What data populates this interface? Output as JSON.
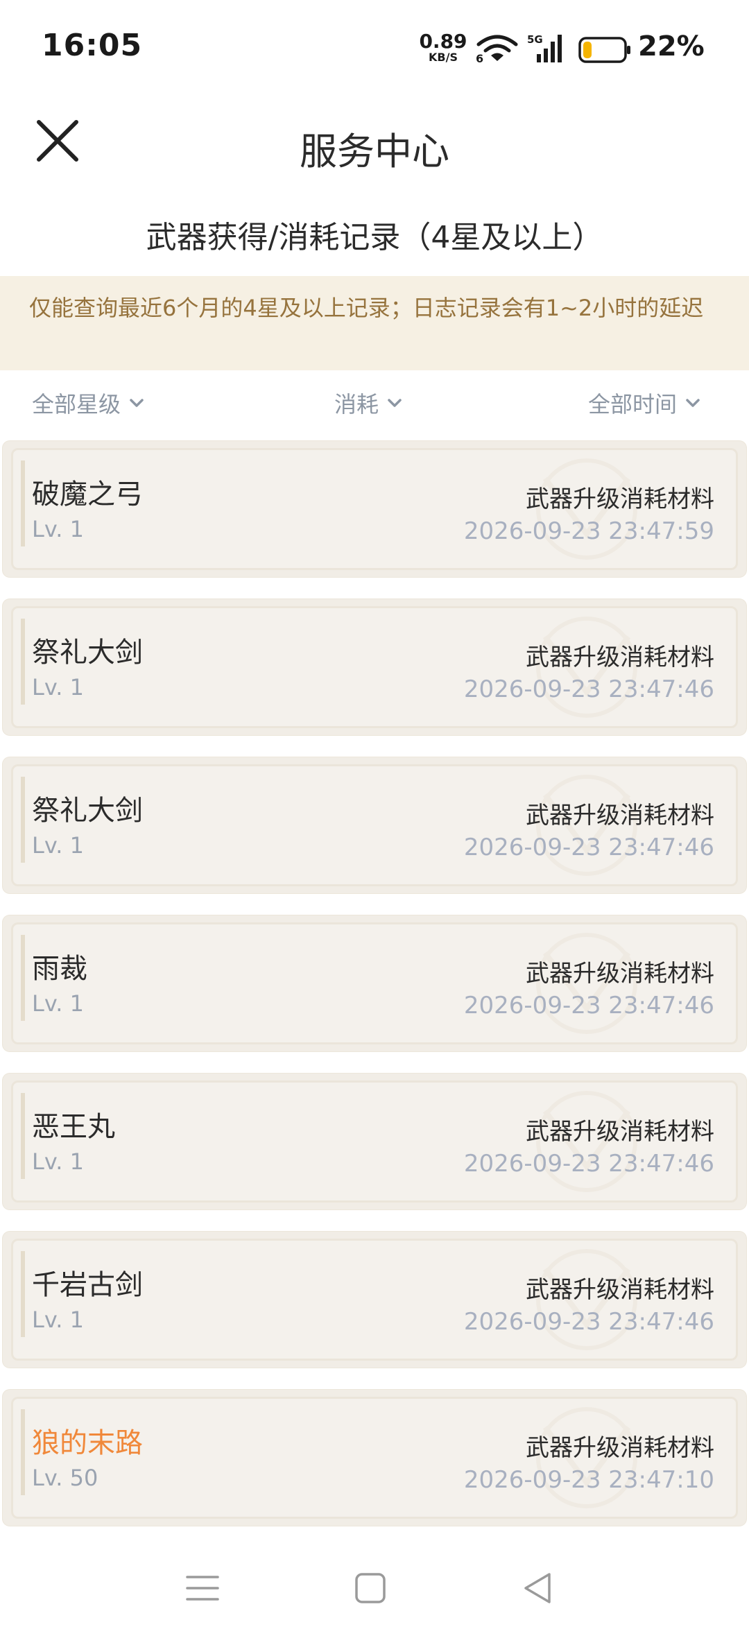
{
  "status_bar": {
    "time": "16:05",
    "net_speed_value": "0.89",
    "net_speed_unit": "KB/S",
    "wifi_badge": "6",
    "signal_badge": "5G",
    "battery_percent": "22%",
    "battery_level": 0.22
  },
  "header": {
    "title": "服务中心",
    "close_icon": "close-icon"
  },
  "section_title": "武器获得/消耗记录（4星及以上）",
  "notice": "仅能查询最近6个月的4星及以上记录；日志记录会有1~2小时的延迟",
  "filters": {
    "rarity": "全部星级",
    "type": "消耗",
    "time": "全部时间"
  },
  "records": [
    {
      "name": "破魔之弓",
      "level": "Lv. 1",
      "type": "武器升级消耗材料",
      "time": "2026-09-23 23:47:59",
      "rarity": "4"
    },
    {
      "name": "祭礼大剑",
      "level": "Lv. 1",
      "type": "武器升级消耗材料",
      "time": "2026-09-23 23:47:46",
      "rarity": "4"
    },
    {
      "name": "祭礼大剑",
      "level": "Lv. 1",
      "type": "武器升级消耗材料",
      "time": "2026-09-23 23:47:46",
      "rarity": "4"
    },
    {
      "name": "雨裁",
      "level": "Lv. 1",
      "type": "武器升级消耗材料",
      "time": "2026-09-23 23:47:46",
      "rarity": "4"
    },
    {
      "name": "恶王丸",
      "level": "Lv. 1",
      "type": "武器升级消耗材料",
      "time": "2026-09-23 23:47:46",
      "rarity": "4"
    },
    {
      "name": "千岩古剑",
      "level": "Lv. 1",
      "type": "武器升级消耗材料",
      "time": "2026-09-23 23:47:46",
      "rarity": "4"
    },
    {
      "name": "狼的末路",
      "level": "Lv. 50",
      "type": "武器升级消耗材料",
      "time": "2026-09-23 23:47:10",
      "rarity": "5"
    }
  ],
  "colors": {
    "rarity_5": "#f0883a",
    "notice_text": "#96733d",
    "notice_bg": "#f6f0e3"
  },
  "nav": {
    "menu_icon": "menu-icon",
    "home_icon": "home-icon",
    "back_icon": "back-icon"
  }
}
